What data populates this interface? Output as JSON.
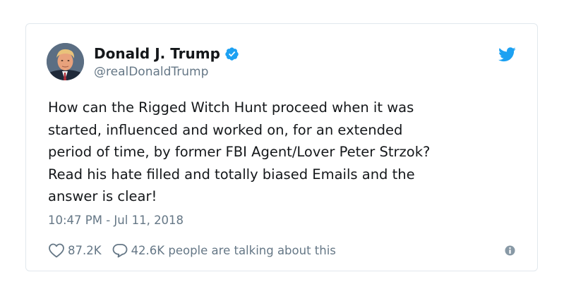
{
  "author": {
    "name": "Donald J. Trump",
    "handle": "@realDonaldTrump",
    "verified": true,
    "avatar_icon": "profile-photo"
  },
  "tweet": {
    "lines": [
      "How can the Rigged Witch Hunt proceed when it was",
      "started, influenced and worked on, for an extended",
      "period of time, by former FBI Agent/Lover Peter Strzok?",
      "Read his hate filled and totally biased Emails and the",
      "answer is clear!"
    ],
    "timestamp": "10:47 PM - Jul 11, 2018"
  },
  "actions": {
    "like_count": "87.2K",
    "reply_text": "42.6K people are talking about this"
  },
  "icons": {
    "brand": "twitter-bird-icon",
    "verified": "verified-badge-icon",
    "like": "heart-icon",
    "reply": "speech-bubble-icon",
    "info": "info-icon"
  },
  "colors": {
    "brand_blue": "#1da1f2",
    "text_primary": "#14171a",
    "text_secondary": "#657786",
    "border": "#e1e8ed"
  }
}
